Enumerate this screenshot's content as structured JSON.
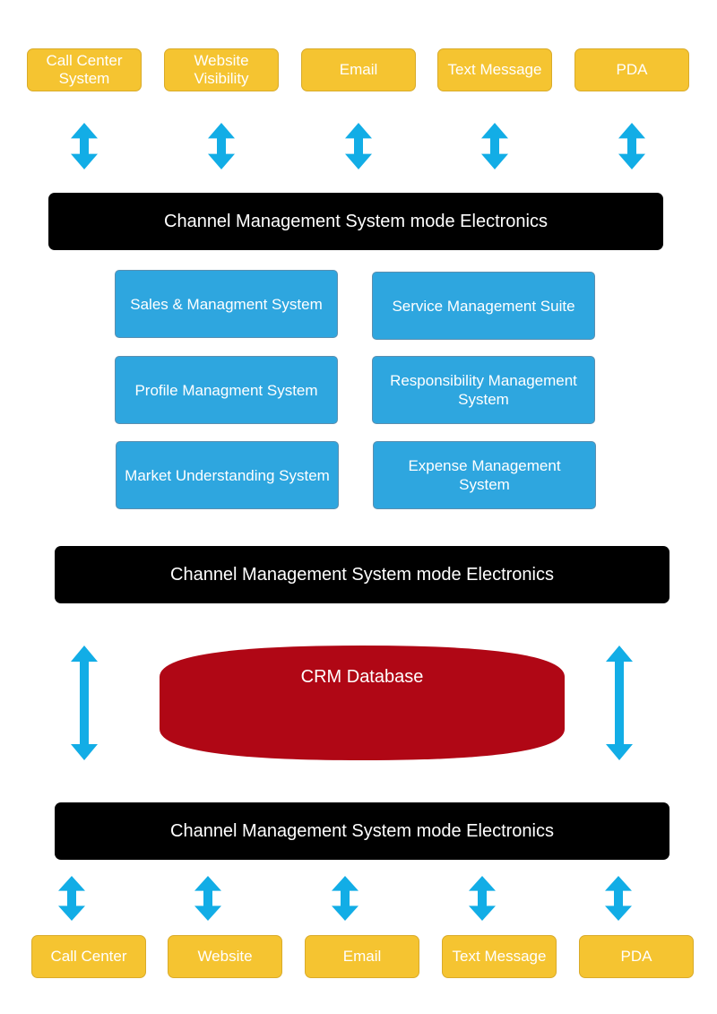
{
  "top_channels": [
    "Call Center System",
    "Website Visibility",
    "Email",
    "Text Message",
    "PDA"
  ],
  "bars": [
    "Channel Management System mode Electronics",
    "Channel Management System mode Electronics",
    "Channel Management System mode Electronics"
  ],
  "modules": [
    "Sales & Managment System",
    "Service Management Suite",
    "Profile Managment System",
    "Responsibility Management System",
    "Market Understanding System",
    "Expense Management System"
  ],
  "database": {
    "label": "CRM Database"
  },
  "bottom_channels": [
    "Call Center",
    "Website",
    "Email",
    "Text Message",
    "PDA"
  ],
  "colors": {
    "channel": "#f5c431",
    "module": "#2ea6df",
    "bar": "#000000",
    "database": "#b00715",
    "arrow": "#12ade6"
  }
}
